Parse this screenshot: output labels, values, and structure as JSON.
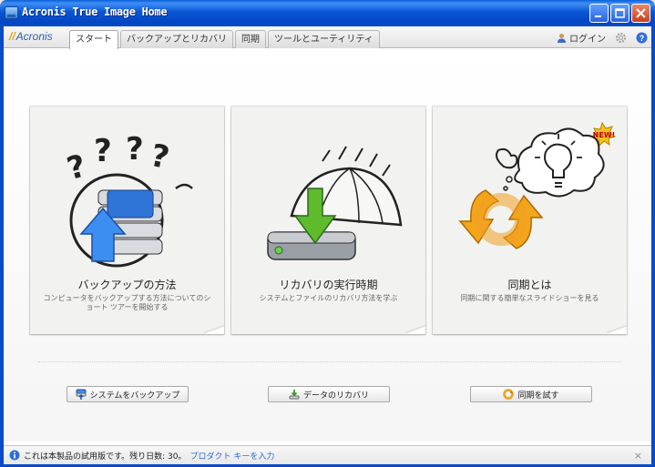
{
  "window": {
    "title": "Acronis True Image Home"
  },
  "header": {
    "logo_text": "Acronis",
    "tabs": [
      {
        "label": "スタート",
        "active": true
      },
      {
        "label": "バックアップとリカバリ",
        "active": false
      },
      {
        "label": "同期",
        "active": false
      },
      {
        "label": "ツールとユーティリティ",
        "active": false
      }
    ],
    "login_label": "ログイン",
    "icons": [
      "user-icon",
      "gear-icon",
      "help-icon"
    ]
  },
  "cards": [
    {
      "title": "バックアップの方法",
      "description": "コンピュータをバックアップする方法についてのショート ツアーを開始する",
      "icon": "backup-disks-icon"
    },
    {
      "title": "リカバリの実行時期",
      "description": "システムとファイルのリカバリ方法を学ぶ",
      "icon": "recovery-umbrella-icon"
    },
    {
      "title": "同期とは",
      "description": "同期に関する簡単なスライドショーを見る",
      "icon": "sync-arrows-icon",
      "badge": "NEW!"
    }
  ],
  "actions": [
    {
      "label": "システムをバックアップ",
      "icon": "backup-icon"
    },
    {
      "label": "データのリカバリ",
      "icon": "recovery-icon"
    },
    {
      "label": "同期を試す",
      "icon": "sync-icon"
    }
  ],
  "statusbar": {
    "message": "これは本製品の試用版です。残り日数: 30。",
    "link": "プロダクト キーを入力",
    "close": "×"
  },
  "colors": {
    "titlebar": "#0A56D5",
    "link": "#2F6FD6",
    "accent_green": "#5DBB2C",
    "accent_orange": "#F0A020"
  }
}
